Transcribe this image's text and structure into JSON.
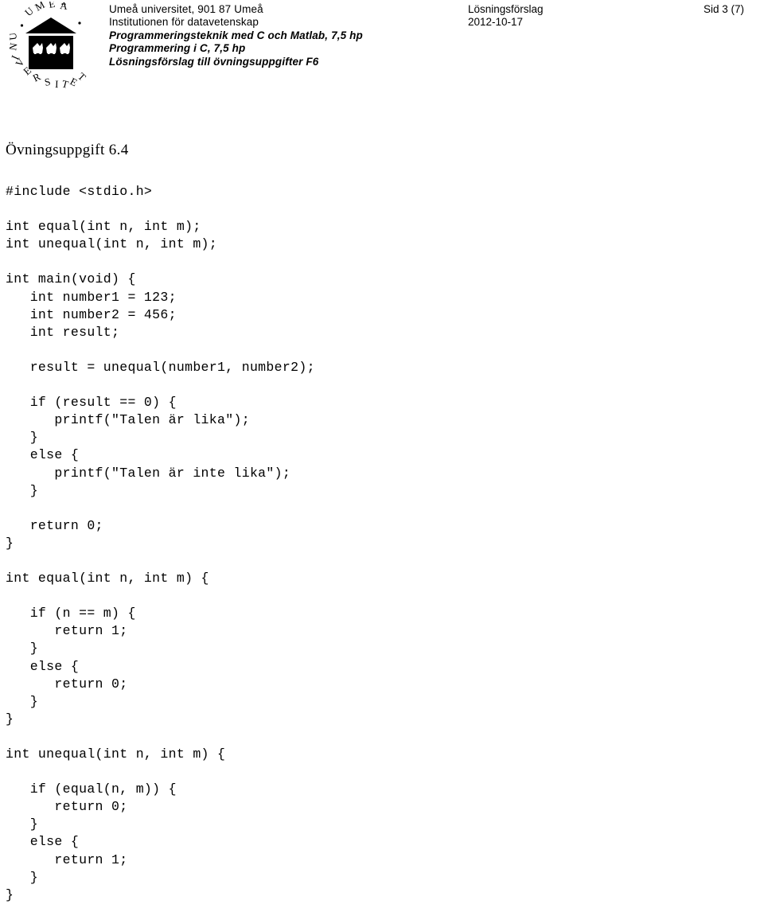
{
  "header": {
    "logo": {
      "icon": "umea-university-seal-logo",
      "ring_text": "UMEÅ UNIVERSITET"
    },
    "organization": [
      {
        "text": "Umeå universitet, 901 87 Umeå",
        "style": "plain"
      },
      {
        "text": "Institutionen för datavetenskap",
        "style": "plain"
      },
      {
        "text": "Programmeringsteknik med C och Matlab, 7,5 hp",
        "style": "bolditalic"
      },
      {
        "text": "Programmering i C, 7,5 hp",
        "style": "bolditalic"
      },
      {
        "text": "Lösningsförslag till övningsuppgifter F6",
        "style": "bolditalic"
      }
    ],
    "document_type": "Lösningsförslag",
    "date": "2012-10-17",
    "page_number": "Sid 3 (7)"
  },
  "main": {
    "exercise_title": "Övningsuppgift 6.4",
    "code_lines": [
      "#include <stdio.h>",
      "",
      "int equal(int n, int m);",
      "int unequal(int n, int m);",
      "",
      "int main(void) {",
      "   int number1 = 123;",
      "   int number2 = 456;",
      "   int result;",
      "",
      "   result = unequal(number1, number2);",
      "",
      "   if (result == 0) {",
      "      printf(\"Talen är lika\");",
      "   }",
      "   else {",
      "      printf(\"Talen är inte lika\");",
      "   }",
      "",
      "   return 0;",
      "}",
      "",
      "int equal(int n, int m) {",
      "",
      "   if (n == m) {",
      "      return 1;",
      "   }",
      "   else {",
      "      return 0;",
      "   }",
      "}",
      "",
      "int unequal(int n, int m) {",
      "",
      "   if (equal(n, m)) {",
      "      return 0;",
      "   }",
      "   else {",
      "      return 1;",
      "   }",
      "}"
    ]
  },
  "colors": {
    "text": "#000000",
    "background": "#ffffff"
  }
}
